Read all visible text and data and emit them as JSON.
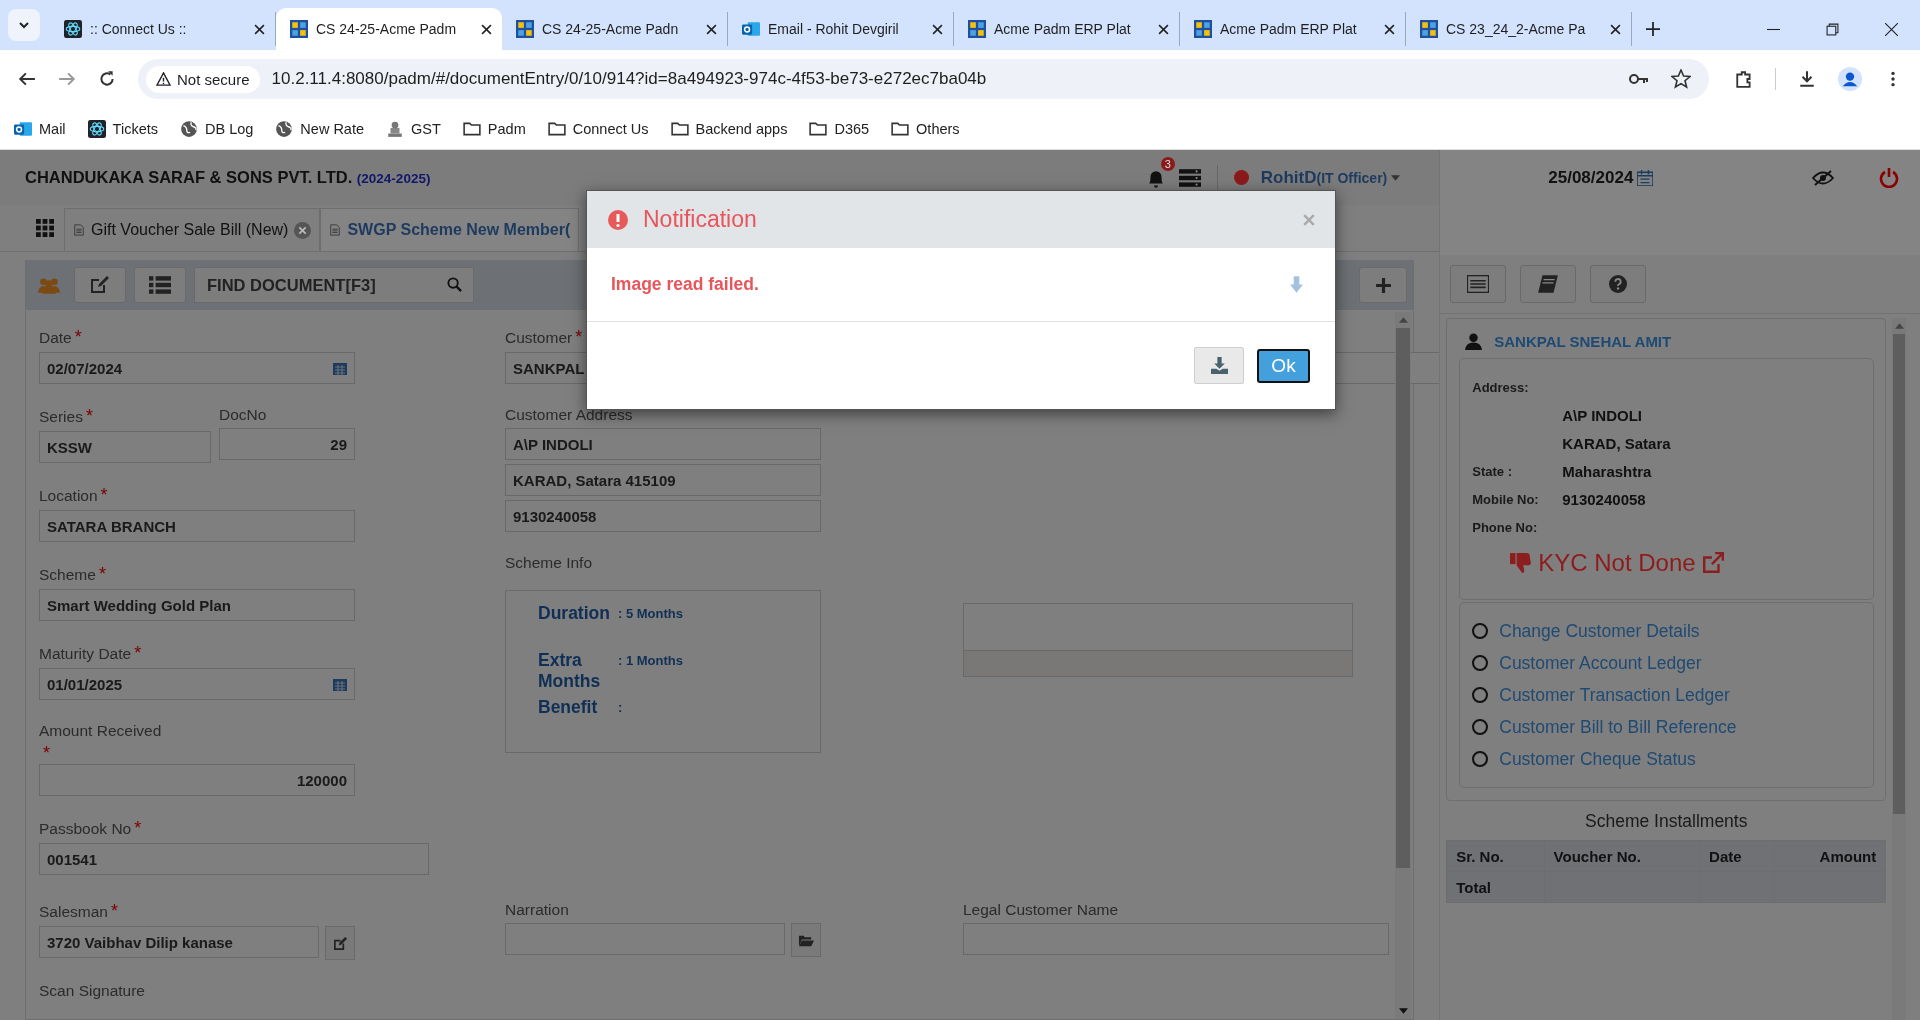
{
  "browser": {
    "tabs": [
      {
        "title": ":: Connect Us ::",
        "selected": false,
        "kind": "react"
      },
      {
        "title": "CS 24-25-Acme Padm",
        "selected": true,
        "kind": "acme"
      },
      {
        "title": "CS 24-25-Acme Padn",
        "selected": false,
        "kind": "acme"
      },
      {
        "title": "Email - Rohit Devgiril",
        "selected": false,
        "kind": "mail"
      },
      {
        "title": "Acme Padm ERP Plat",
        "selected": false,
        "kind": "acme"
      },
      {
        "title": "Acme Padm ERP Plat",
        "selected": false,
        "kind": "acme"
      },
      {
        "title": "CS 23_24_2-Acme Pa",
        "selected": false,
        "kind": "acme"
      }
    ],
    "not_secure": "Not secure",
    "url": "10.2.11.4:8080/padm/#/documentEntry/0/10/914?id=8a494923-974c-4f53-be73-e272ec7ba04b",
    "bookmarks": [
      {
        "label": "Mail",
        "kind": "mail"
      },
      {
        "label": "Tickets",
        "kind": "react"
      },
      {
        "label": "DB Log",
        "kind": "globe"
      },
      {
        "label": "New Rate",
        "kind": "globe"
      },
      {
        "label": "GST",
        "kind": "emblem"
      },
      {
        "label": "Padm",
        "kind": "folder"
      },
      {
        "label": "Connect Us",
        "kind": "folder"
      },
      {
        "label": "Backend apps",
        "kind": "folder"
      },
      {
        "label": "D365",
        "kind": "folder"
      },
      {
        "label": "Others",
        "kind": "folder"
      }
    ]
  },
  "app": {
    "company": "CHANDUKAKA SARAF & SONS PVT. LTD.",
    "year": "(2024-2025)",
    "notifications": "3",
    "user": "RohitD",
    "role": "(IT Officer)",
    "date": "25/08/2024"
  },
  "doc_tabs": [
    {
      "label": "Gift Voucher Sale Bill (New)",
      "selected": false,
      "closable": true
    },
    {
      "label": "SWGP Scheme New Member(",
      "selected": true,
      "closable": false
    }
  ],
  "find": {
    "placeholder": "FIND DOCUMENT[F3]"
  },
  "form": {
    "date": {
      "label": "Date",
      "mark": "*",
      "value": "02/07/2024"
    },
    "series": {
      "label": "Series",
      "mark": "*",
      "value": "KSSW"
    },
    "doc_no": {
      "label": "DocNo",
      "value": "29"
    },
    "location": {
      "label": "Location",
      "mark": "*",
      "value": "SATARA BRANCH"
    },
    "scheme": {
      "label": "Scheme",
      "mark": "*",
      "value": "Smart Wedding Gold Plan"
    },
    "maturity_date": {
      "label": "Maturity Date",
      "mark": "*",
      "value": "01/01/2025"
    },
    "amount_received": {
      "label": "Amount Received",
      "mark": "*",
      "value": "120000"
    },
    "passbook_no": {
      "label": "Passbook No",
      "mark": "*",
      "value": "001541"
    },
    "salesman": {
      "label": "Salesman",
      "mark": "*",
      "value": "3720 Vaibhav Dilip kanase"
    },
    "customer": {
      "label": "Customer",
      "mark": "*",
      "value": "SANKPAL"
    },
    "customer_address": {
      "label": "Customer Address",
      "lines": [
        "A\\P INDOLI",
        "KARAD, Satara 415109",
        "9130240058"
      ]
    },
    "scheme_info": {
      "label": "Scheme Info",
      "rows": [
        {
          "label": "Duration",
          "value": ": 5 Months"
        },
        {
          "label": "Extra Months",
          "value": ": 1 Months"
        },
        {
          "label": "Benefit",
          "value": ":"
        }
      ]
    },
    "narration": {
      "label": "Narration"
    },
    "legal_customer_name": {
      "label": "Legal Customer Name"
    },
    "scan_signature": {
      "label": "Scan Signature"
    }
  },
  "customer_panel": {
    "name": "SANKPAL SNEHAL AMIT",
    "address_label": "Address:",
    "address_lines": [
      "A\\P INDOLI",
      "KARAD, Satara"
    ],
    "state_label": "State :",
    "state": "Maharashtra",
    "mobile_label": "Mobile No:",
    "mobile": "9130240058",
    "phone_label": "Phone No:",
    "kyc": "KYC Not Done",
    "links": [
      {
        "label": "Change Customer Details",
        "selected": false
      },
      {
        "label": "Customer Account Ledger",
        "selected": false
      },
      {
        "label": "Customer Transaction Ledger",
        "selected": false
      },
      {
        "label": "Customer Bill to Bill Reference",
        "selected": false
      },
      {
        "label": "Customer Cheque Status",
        "selected": false
      }
    ]
  },
  "installments": {
    "title": "Scheme Installments",
    "columns": [
      "Sr. No.",
      "Voucher No.",
      "Date",
      "Amount"
    ],
    "total_label": "Total"
  },
  "modal": {
    "title": "Notification",
    "message": "Image read failed.",
    "ok": "Ok"
  }
}
